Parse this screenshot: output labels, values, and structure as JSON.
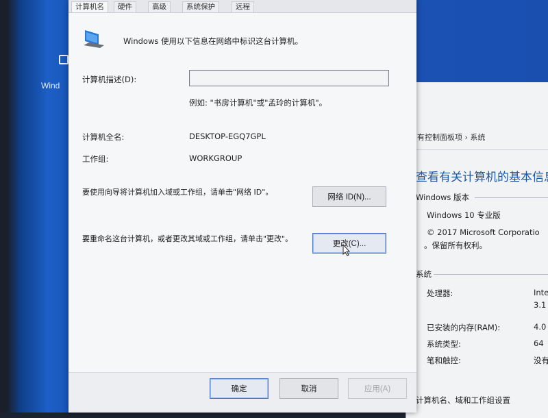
{
  "desktop": {
    "icon_label": "Wind"
  },
  "dialog": {
    "tabs": [
      {
        "label": "计算机名"
      },
      {
        "label": "硬件"
      },
      {
        "label": "高级"
      },
      {
        "label": "系统保护"
      },
      {
        "label": "远程"
      }
    ],
    "intro": "Windows 使用以下信息在网络中标识这台计算机。",
    "description_label": "计算机描述(D):",
    "description_value": "",
    "example_text": "例如: \"书房计算机\"或\"孟玲的计算机\"。",
    "full_name_label": "计算机全名:",
    "full_name_value": "DESKTOP-EGQ7GPL",
    "workgroup_label": "工作组:",
    "workgroup_value": "WORKGROUP",
    "network_id_text": "要使用向导将计算机加入域或工作组，请单击\"网络 ID\"。",
    "network_id_button": "网络 ID(N)...",
    "rename_text": "要重命名这台计算机，或者更改其域或工作组，请单击\"更改\"。",
    "change_button": "更改(C)...",
    "ok_button": "确定",
    "cancel_button": "取消",
    "apply_button": "应用(A)"
  },
  "system_window": {
    "breadcrumb": "有控制面板项  ›  系统",
    "heading": "查看有关计算机的基本信息",
    "edition_section": "Windows 版本",
    "edition_value": "Windows 10 专业版",
    "copyright_line1": "© 2017 Microsoft Corporatio",
    "copyright_line2": "。保留所有权利。",
    "system_section": "系统",
    "processor_label": "处理器:",
    "processor_value_1": "Inte",
    "processor_value_2": "3.1",
    "ram_label": "已安装的内存(RAM):",
    "ram_value": "4.0",
    "type_label": "系统类型:",
    "type_value": "64",
    "pen_label": "笔和触控:",
    "pen_value": "没有",
    "footer_section": "计算机名、域和工作组设置"
  },
  "colors": {
    "accent": "#1f57a4",
    "focus_border": "#4a76c2",
    "wallpaper": "#1a57bb"
  }
}
